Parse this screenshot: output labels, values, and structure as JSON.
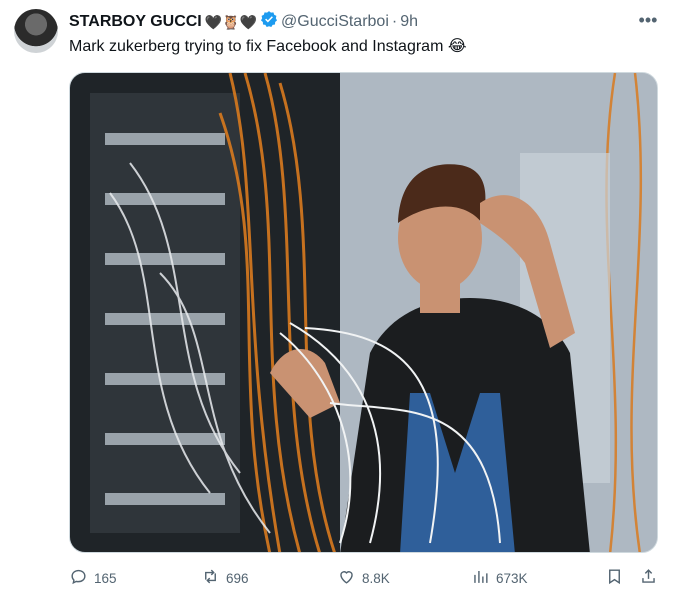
{
  "author": {
    "display_name": "STARBOY GUCCI",
    "emoji": "🖤🦉🖤",
    "handle": "@GucciStarboi",
    "separator": "·",
    "time": "9h"
  },
  "tweet": {
    "text": "Mark zukerberg trying to fix Facebook and Instagram 😂"
  },
  "actions": {
    "reply_count": "165",
    "retweet_count": "696",
    "like_count": "8.8K",
    "views_count": "673K"
  },
  "colors": {
    "text": "#0f1419",
    "muted": "#536471",
    "verified": "#1d9bf0"
  },
  "icons": [
    "more-icon",
    "verified-badge-icon",
    "reply-icon",
    "retweet-icon",
    "like-icon",
    "views-icon",
    "bookmark-icon",
    "share-icon"
  ]
}
